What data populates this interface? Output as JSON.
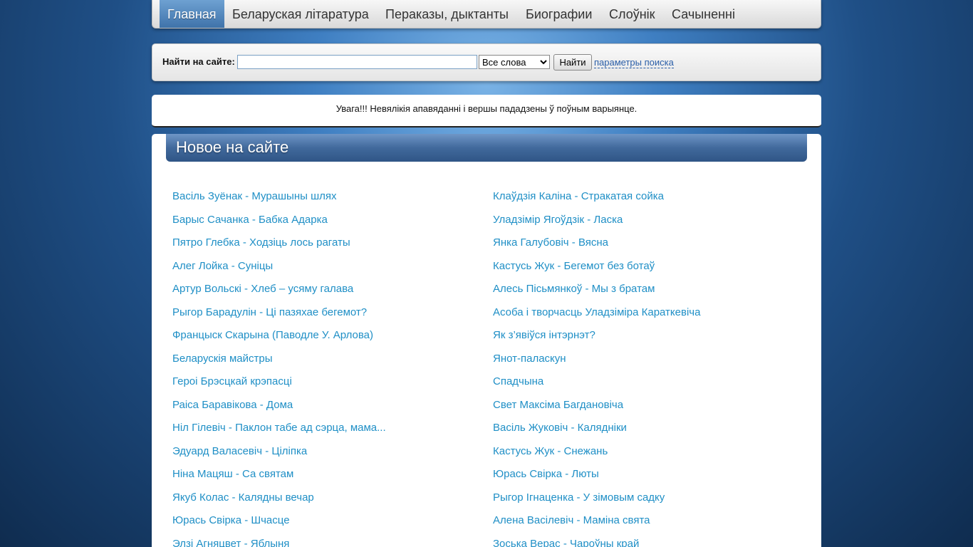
{
  "nav": {
    "items": [
      {
        "label": "Главная",
        "active": true
      },
      {
        "label": "Беларуская літаратура",
        "active": false
      },
      {
        "label": "Пераказы, дыктанты",
        "active": false
      },
      {
        "label": "Биографии",
        "active": false
      },
      {
        "label": "Слоўнік",
        "active": false
      },
      {
        "label": "Сачыненні",
        "active": false
      }
    ]
  },
  "search": {
    "label": "Найти на сайте:",
    "value": "",
    "mode_selected": "Все слова",
    "button": "Найти",
    "params_link": "параметры поиска"
  },
  "notice": "Увага!!! Невялікія апавяданні і вершы пададзены ў поўным варыянце.",
  "section": {
    "title": "Новое на сайте",
    "left_links": [
      "Васіль Зуёнак - Мурашыны шлях",
      "Барыс Сачанка - Бабка Адарка",
      "Пятро Глебка - Ходзіць лось рагаты",
      "Алег Лойка - Суніцы",
      "Артур Вольскі - Хлеб – усяму галава",
      "Рыгор Барадулін - Ці пазяхае бегемот?",
      "Францыск Скарына (Паводле У. Арлова)",
      "Беларускія майстры",
      "Героі Брэсцкай крэпасці",
      "Раіса Баравікова - Дома",
      "Ніл Гілевіч - Паклон табе ад сэрца, мама...",
      "Эдуард Валасевіч - Ціліпка",
      "Ніна Мацяш - Са святам",
      "Якуб Колас - Калядны вечар",
      "Юрась Свірка - Шчасце",
      "Элзі Агняцвет - Яблыня"
    ],
    "right_links": [
      "Клаўдзія Каліна - Стракатая сойка",
      "Уладзімір Ягоўдзік - Ласка",
      "Янка Галубовіч - Вясна",
      "Кастусь Жук - Бегемот без ботаў",
      "Алесь Пісьмянкоў - Мы з братам",
      "Асоба і творчасць Уладзіміра Караткевіча",
      "Як з’явіўся інтэрнэт?",
      "Янот-паласкун",
      "Спадчына",
      "Свет Максіма Багдановіча",
      "Васіль Жуковіч - Калядніки",
      "Кастусь Жук - Снежань",
      "Юрась Свірка - Люты",
      "Рыгор Ігнаценка - У зімовым садку",
      "Алена Васілевіч - Маміна свята",
      "Зоська Верас - Чароўны край"
    ]
  }
}
